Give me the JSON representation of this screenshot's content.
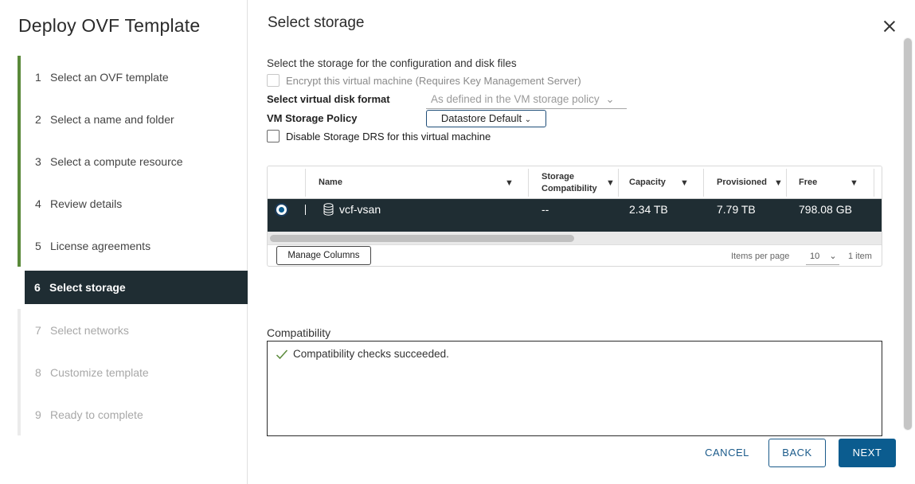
{
  "wizard": {
    "title": "Deploy OVF Template",
    "steps": [
      {
        "num": "1",
        "label": "Select an OVF template",
        "state": "done"
      },
      {
        "num": "2",
        "label": "Select a name and folder",
        "state": "done"
      },
      {
        "num": "3",
        "label": "Select a compute resource",
        "state": "done"
      },
      {
        "num": "4",
        "label": "Review details",
        "state": "done"
      },
      {
        "num": "5",
        "label": "License agreements",
        "state": "done"
      },
      {
        "num": "6",
        "label": "Select storage",
        "state": "active"
      },
      {
        "num": "7",
        "label": "Select networks",
        "state": "todo"
      },
      {
        "num": "8",
        "label": "Customize template",
        "state": "todo"
      },
      {
        "num": "9",
        "label": "Ready to complete",
        "state": "todo"
      }
    ]
  },
  "page": {
    "title": "Select storage",
    "description": "Select the storage for the configuration and disk files",
    "encrypt_label": "Encrypt this virtual machine (Requires Key Management Server)",
    "disk_format_label": "Select virtual disk format",
    "disk_format_value": "As defined in the VM storage policy",
    "storage_policy_label": "VM Storage Policy",
    "storage_policy_value": "Datastore Default",
    "disable_drs_label": "Disable Storage DRS for this virtual machine"
  },
  "grid": {
    "columns": {
      "name": "Name",
      "compat_line1": "Storage",
      "compat_line2": "Compatibility",
      "capacity": "Capacity",
      "provisioned": "Provisioned",
      "free": "Free"
    },
    "rows": [
      {
        "name": "vcf-vsan",
        "compatibility": "--",
        "capacity": "2.34 TB",
        "provisioned": "7.79 TB",
        "free": "798.08 GB",
        "selected": true
      }
    ],
    "manage_columns": "Manage Columns",
    "items_per_page_label": "Items per page",
    "items_per_page_value": "10",
    "item_count": "1 item"
  },
  "compatibility": {
    "label": "Compatibility",
    "message": "Compatibility checks succeeded."
  },
  "buttons": {
    "cancel": "CANCEL",
    "back": "BACK",
    "next": "NEXT"
  },
  "colors": {
    "accent": "#0b5c8f",
    "step_done_bar": "#5a8a3a",
    "selected_bg": "#1f2d33",
    "success": "#5a8a3a"
  }
}
